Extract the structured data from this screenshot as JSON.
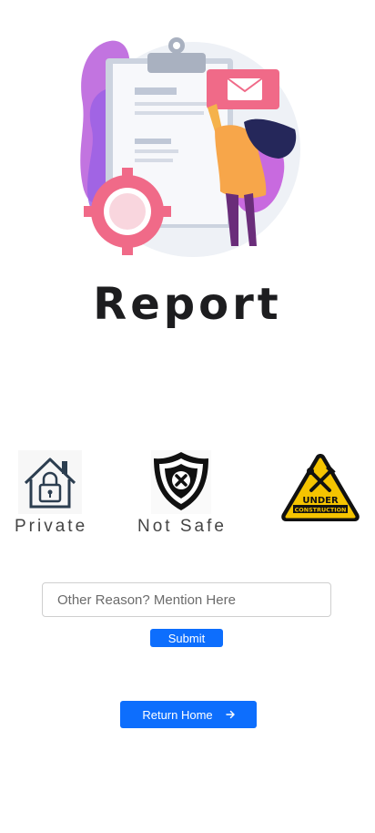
{
  "page": {
    "title": "Report"
  },
  "options": [
    {
      "label": "Private",
      "icon": "lock-house-icon"
    },
    {
      "label": "Not Safe",
      "icon": "shield-x-icon"
    },
    {
      "label": "",
      "icon": "under-construction-icon",
      "sign_text": [
        "UNDER",
        "CONSTRUCTION"
      ]
    }
  ],
  "form": {
    "placeholder": "Other Reason? Mention Here",
    "submit_label": "Submit"
  },
  "home": {
    "label": "Return Home",
    "icon": "arrow-right-icon"
  },
  "colors": {
    "primary": "#0d6efd",
    "sign_yellow": "#f5c400",
    "accent_pink": "#f06a88"
  }
}
